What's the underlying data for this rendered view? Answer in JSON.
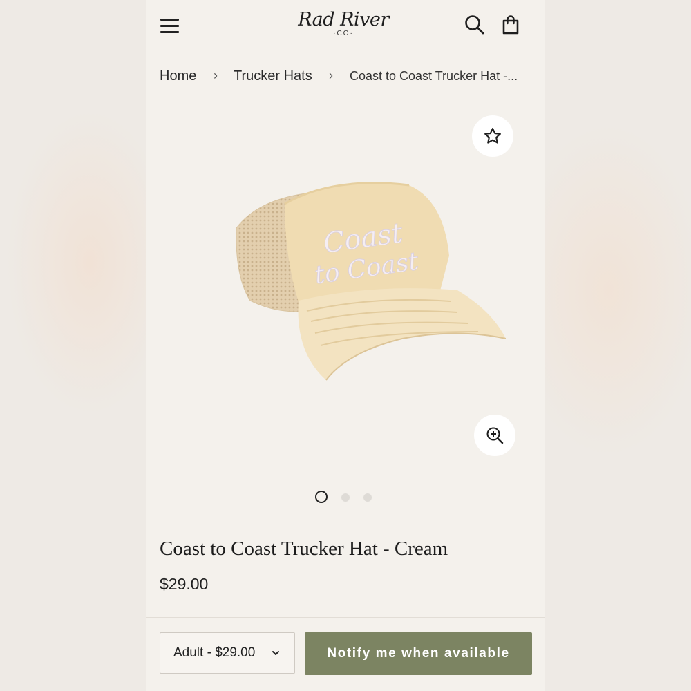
{
  "header": {
    "logo_main": "Rad River",
    "logo_sub": "·CO·"
  },
  "breadcrumb": {
    "home": "Home",
    "category": "Trucker Hats",
    "current": "Coast to Coast Trucker Hat -...",
    "separator": "›"
  },
  "product": {
    "image_embroidery": "Coast to Coast",
    "title": "Coast to Coast Trucker Hat - Cream",
    "price": "$29.00",
    "gallery_total": 3,
    "gallery_active_index": 0
  },
  "purchase": {
    "variant_selected": "Adult - $29.00",
    "notify_label": "Notify me when available"
  },
  "colors": {
    "notify_button": "#7c8462",
    "page_background": "#f4f1ec",
    "hat_cream": "#f0dcb2"
  },
  "icons": {
    "menu": "hamburger-menu-icon",
    "search": "search-icon",
    "cart": "shopping-bag-icon",
    "favorite": "star-icon",
    "zoom": "zoom-in-icon",
    "dropdown": "chevron-down-icon"
  }
}
